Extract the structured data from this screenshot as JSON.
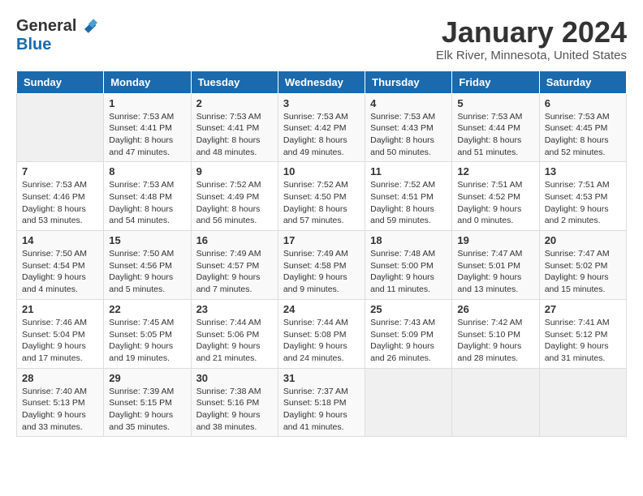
{
  "header": {
    "logo": {
      "general": "General",
      "blue": "Blue"
    },
    "title": "January 2024",
    "location": "Elk River, Minnesota, United States"
  },
  "weekdays": [
    "Sunday",
    "Monday",
    "Tuesday",
    "Wednesday",
    "Thursday",
    "Friday",
    "Saturday"
  ],
  "weeks": [
    [
      {
        "day": "",
        "empty": true
      },
      {
        "day": "1",
        "sunrise": "7:53 AM",
        "sunset": "4:41 PM",
        "daylight": "8 hours and 47 minutes."
      },
      {
        "day": "2",
        "sunrise": "7:53 AM",
        "sunset": "4:41 PM",
        "daylight": "8 hours and 48 minutes."
      },
      {
        "day": "3",
        "sunrise": "7:53 AM",
        "sunset": "4:42 PM",
        "daylight": "8 hours and 49 minutes."
      },
      {
        "day": "4",
        "sunrise": "7:53 AM",
        "sunset": "4:43 PM",
        "daylight": "8 hours and 50 minutes."
      },
      {
        "day": "5",
        "sunrise": "7:53 AM",
        "sunset": "4:44 PM",
        "daylight": "8 hours and 51 minutes."
      },
      {
        "day": "6",
        "sunrise": "7:53 AM",
        "sunset": "4:45 PM",
        "daylight": "8 hours and 52 minutes."
      }
    ],
    [
      {
        "day": "7",
        "sunrise": "7:53 AM",
        "sunset": "4:46 PM",
        "daylight": "8 hours and 53 minutes."
      },
      {
        "day": "8",
        "sunrise": "7:53 AM",
        "sunset": "4:48 PM",
        "daylight": "8 hours and 54 minutes."
      },
      {
        "day": "9",
        "sunrise": "7:52 AM",
        "sunset": "4:49 PM",
        "daylight": "8 hours and 56 minutes."
      },
      {
        "day": "10",
        "sunrise": "7:52 AM",
        "sunset": "4:50 PM",
        "daylight": "8 hours and 57 minutes."
      },
      {
        "day": "11",
        "sunrise": "7:52 AM",
        "sunset": "4:51 PM",
        "daylight": "8 hours and 59 minutes."
      },
      {
        "day": "12",
        "sunrise": "7:51 AM",
        "sunset": "4:52 PM",
        "daylight": "9 hours and 0 minutes."
      },
      {
        "day": "13",
        "sunrise": "7:51 AM",
        "sunset": "4:53 PM",
        "daylight": "9 hours and 2 minutes."
      }
    ],
    [
      {
        "day": "14",
        "sunrise": "7:50 AM",
        "sunset": "4:54 PM",
        "daylight": "9 hours and 4 minutes."
      },
      {
        "day": "15",
        "sunrise": "7:50 AM",
        "sunset": "4:56 PM",
        "daylight": "9 hours and 5 minutes."
      },
      {
        "day": "16",
        "sunrise": "7:49 AM",
        "sunset": "4:57 PM",
        "daylight": "9 hours and 7 minutes."
      },
      {
        "day": "17",
        "sunrise": "7:49 AM",
        "sunset": "4:58 PM",
        "daylight": "9 hours and 9 minutes."
      },
      {
        "day": "18",
        "sunrise": "7:48 AM",
        "sunset": "5:00 PM",
        "daylight": "9 hours and 11 minutes."
      },
      {
        "day": "19",
        "sunrise": "7:47 AM",
        "sunset": "5:01 PM",
        "daylight": "9 hours and 13 minutes."
      },
      {
        "day": "20",
        "sunrise": "7:47 AM",
        "sunset": "5:02 PM",
        "daylight": "9 hours and 15 minutes."
      }
    ],
    [
      {
        "day": "21",
        "sunrise": "7:46 AM",
        "sunset": "5:04 PM",
        "daylight": "9 hours and 17 minutes."
      },
      {
        "day": "22",
        "sunrise": "7:45 AM",
        "sunset": "5:05 PM",
        "daylight": "9 hours and 19 minutes."
      },
      {
        "day": "23",
        "sunrise": "7:44 AM",
        "sunset": "5:06 PM",
        "daylight": "9 hours and 21 minutes."
      },
      {
        "day": "24",
        "sunrise": "7:44 AM",
        "sunset": "5:08 PM",
        "daylight": "9 hours and 24 minutes."
      },
      {
        "day": "25",
        "sunrise": "7:43 AM",
        "sunset": "5:09 PM",
        "daylight": "9 hours and 26 minutes."
      },
      {
        "day": "26",
        "sunrise": "7:42 AM",
        "sunset": "5:10 PM",
        "daylight": "9 hours and 28 minutes."
      },
      {
        "day": "27",
        "sunrise": "7:41 AM",
        "sunset": "5:12 PM",
        "daylight": "9 hours and 31 minutes."
      }
    ],
    [
      {
        "day": "28",
        "sunrise": "7:40 AM",
        "sunset": "5:13 PM",
        "daylight": "9 hours and 33 minutes."
      },
      {
        "day": "29",
        "sunrise": "7:39 AM",
        "sunset": "5:15 PM",
        "daylight": "9 hours and 35 minutes."
      },
      {
        "day": "30",
        "sunrise": "7:38 AM",
        "sunset": "5:16 PM",
        "daylight": "9 hours and 38 minutes."
      },
      {
        "day": "31",
        "sunrise": "7:37 AM",
        "sunset": "5:18 PM",
        "daylight": "9 hours and 41 minutes."
      },
      {
        "day": "",
        "empty": true
      },
      {
        "day": "",
        "empty": true
      },
      {
        "day": "",
        "empty": true
      }
    ]
  ]
}
